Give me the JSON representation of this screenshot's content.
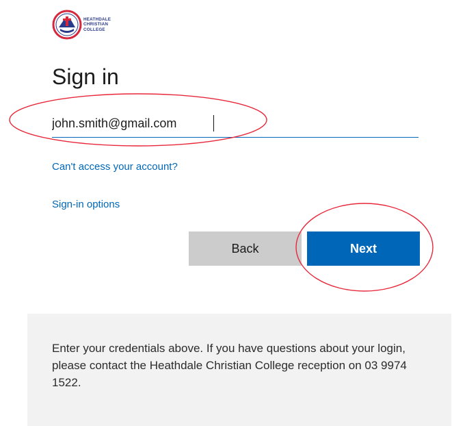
{
  "logo": {
    "name_lines": [
      "HEATHDALE",
      "CHRISTIAN",
      "COLLEGE"
    ],
    "colors": {
      "primary": "#2a3a8a",
      "accent": "#d6283d"
    }
  },
  "title": "Sign in",
  "email": {
    "value": "john.smith@gmail.com"
  },
  "links": {
    "cant_access": "Can't access your account?",
    "sign_in_options": "Sign-in options"
  },
  "buttons": {
    "back": "Back",
    "next": "Next"
  },
  "info": {
    "text": "Enter your credentials above. If you have questions about your login, please contact the Heathdale Christian College reception on 03 9974 1522."
  },
  "colors": {
    "accent": "#0067b8",
    "back_button": "#cccccc",
    "panel": "#f2f2f2",
    "annotation": "#e8273a"
  }
}
